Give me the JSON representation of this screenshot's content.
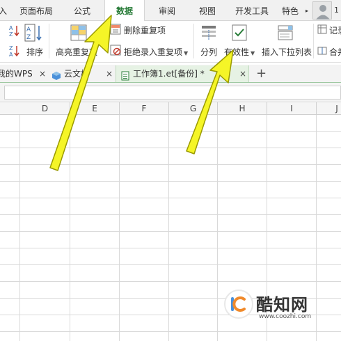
{
  "menu": {
    "tabs": [
      {
        "label": "页面布局"
      },
      {
        "label": "公式"
      },
      {
        "label": "数据"
      },
      {
        "label": "审阅"
      },
      {
        "label": "视图"
      },
      {
        "label": "开发工具"
      },
      {
        "label": "特色"
      }
    ],
    "user_count": "1"
  },
  "ribbon": {
    "sort_label": "排序",
    "highlight_dup_label": "高亮重复项",
    "delete_dup_label": "删除重复项",
    "reject_dup_label": "拒绝录入重复项",
    "split_label": "分列",
    "validity_label": "有效性",
    "insert_dropdown_label": "插入下拉列表",
    "record_label": "记录",
    "merge_label": "合并"
  },
  "doctabs": {
    "tabs": [
      {
        "label": "我的WPS"
      },
      {
        "label": "云文档"
      },
      {
        "label": "工作簿1.et[备份] *"
      }
    ]
  },
  "columns": [
    "D",
    "E",
    "F",
    "G",
    "H",
    "I",
    "J"
  ],
  "watermark": {
    "brand": "酷知网",
    "url": "www.coozhi.com"
  },
  "colors": {
    "active_tab_text": "#2a7d3a",
    "arrow_fill": "#f5f527",
    "arrow_stroke": "#9a9a00"
  }
}
